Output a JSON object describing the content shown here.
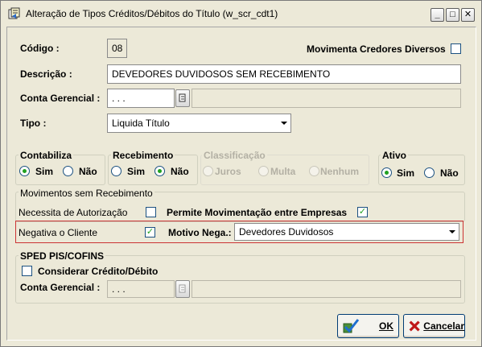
{
  "window": {
    "title": "Alteração de Tipos Créditos/Débitos do Título (w_scr_cdt1)",
    "controls": {
      "minimize": "_",
      "maximize": "□",
      "close": "✕"
    }
  },
  "form": {
    "codigo_label": "Código :",
    "codigo_value": "08",
    "movimenta_label": "Movimenta Credores Diversos",
    "movimenta_checked": false,
    "descricao_label": "Descrição :",
    "descricao_value": "DEVEDORES DUVIDOSOS SEM RECEBIMENTO",
    "conta_label": "Conta Gerencial :",
    "conta_value": ". . .",
    "tipo_label": "Tipo :",
    "tipo_value": "Liquida Título"
  },
  "groups": {
    "contabiliza": {
      "title": "Contabiliza",
      "options": [
        "Sim",
        "Não"
      ],
      "selected": "Sim"
    },
    "recebimento": {
      "title": "Recebimento",
      "options": [
        "Sim",
        "Não"
      ],
      "selected": "Não"
    },
    "classificacao": {
      "title": "Classificação",
      "options": [
        "Juros",
        "Multa",
        "Nenhum"
      ],
      "selected": null,
      "disabled": true
    },
    "ativo": {
      "title": "Ativo",
      "options": [
        "Sim",
        "Não"
      ],
      "selected": "Sim"
    }
  },
  "movimentos": {
    "title": "Movimentos sem Recebimento",
    "necessita_label": "Necessita de Autorização",
    "necessita_checked": false,
    "permite_label": "Permite Movimentação entre Empresas",
    "permite_checked": true,
    "negativa_label": "Negativa o Cliente",
    "negativa_checked": true,
    "motivo_label": "Motivo Nega.:",
    "motivo_value": "Devedores Duvidosos"
  },
  "sped": {
    "title": "SPED PIS/COFINS",
    "considerar_label": "Considerar Crédito/Débito",
    "considerar_checked": false,
    "conta_label": "Conta Gerencial :",
    "conta_value": ". . ."
  },
  "buttons": {
    "ok": "OK",
    "cancel": "Cancelar"
  },
  "colors": {
    "accent_check": "#21a121",
    "highlight_border": "#cc3333",
    "window_bg": "#ECE9D8"
  }
}
